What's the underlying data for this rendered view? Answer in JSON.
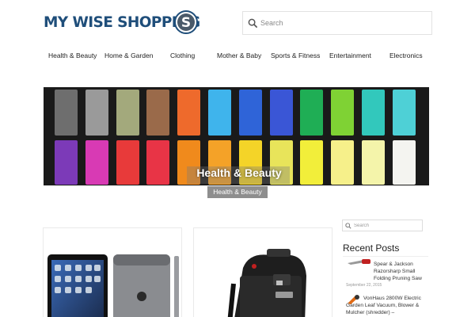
{
  "logo": {
    "text": "MY WISE SHOPPING",
    "badge_letter": "S",
    "brand_color": "#1f4e7a"
  },
  "search": {
    "placeholder": "Search",
    "icon": "search-icon"
  },
  "nav": {
    "items": [
      "Health & Beauty",
      "Home & Garden",
      "Clothing",
      "Mother & Baby",
      "Sports & Fitness",
      "Entertainment",
      "Electronics"
    ]
  },
  "slider": {
    "title": "Health & Beauty",
    "tag": "Health & Beauty",
    "top_row_colors": [
      "#6e6e6e",
      "#9a9a9a",
      "#a3a97c",
      "#9a6a4a",
      "#ee6a2c",
      "#3fb4ec",
      "#2f64d8",
      "#3a56d6",
      "#1fae55",
      "#7fd234",
      "#32c8bc",
      "#4ed0d6"
    ],
    "bottom_row_colors": [
      "#7c3ab8",
      "#d83ab4",
      "#e83a3a",
      "#e83446",
      "#f08a1c",
      "#f4a228",
      "#f4d428",
      "#e8e45a",
      "#f2ee3a",
      "#f6f08a",
      "#f4f4aa",
      "#f4f4f0"
    ]
  },
  "sidebar": {
    "search_placeholder": "Search",
    "recent_title": "Recent Posts",
    "posts": [
      {
        "title": "Spear & Jackson Razorsharp Small Folding Pruning Saw",
        "date": "September 22, 2015"
      },
      {
        "title": "VonHaus 2800W Electric Garden Leaf Vacuum, Blower & Mulcher (shredder) –",
        "date": ""
      }
    ]
  }
}
